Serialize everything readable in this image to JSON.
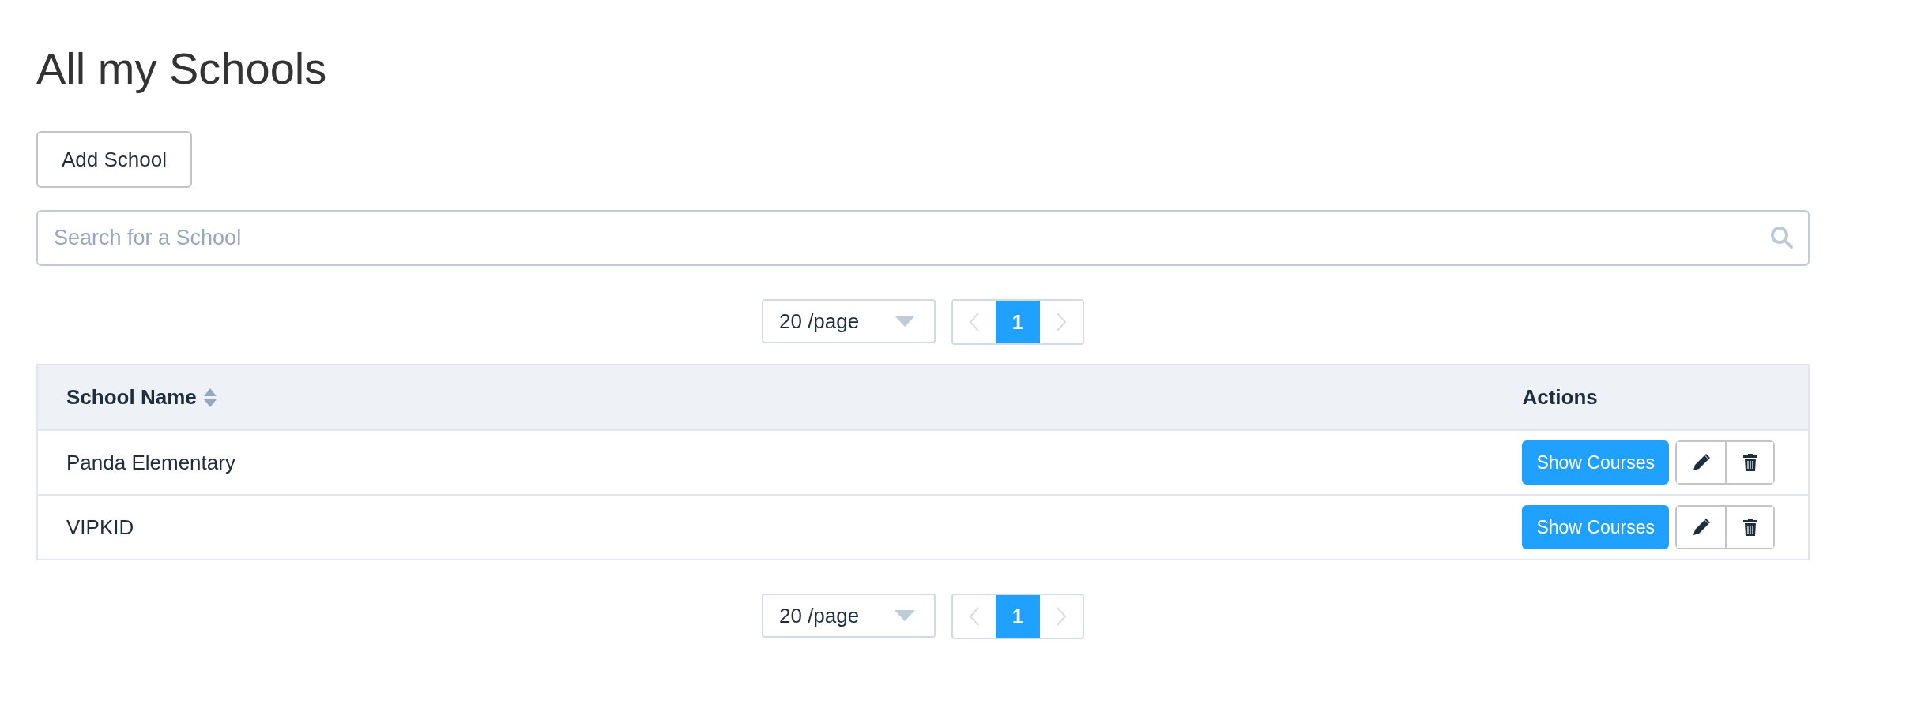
{
  "title": "All my Schools",
  "add_button": "Add School",
  "search": {
    "placeholder": "Search for a School"
  },
  "pagination_top": {
    "page_size": "20 /page",
    "pages": [
      {
        "label": "1",
        "selected": true
      }
    ]
  },
  "table": {
    "columns": [
      {
        "label": "School Name",
        "sortable": true
      },
      {
        "label": "Actions",
        "sortable": false
      }
    ],
    "rows": [
      {
        "name": "Panda Elementary",
        "action": "Show Courses"
      },
      {
        "name": "VIPKID",
        "action": "Show Courses"
      }
    ]
  },
  "pagination_bottom": {
    "page_size": "20 /page",
    "pages": [
      {
        "label": "1",
        "selected": true
      }
    ]
  }
}
